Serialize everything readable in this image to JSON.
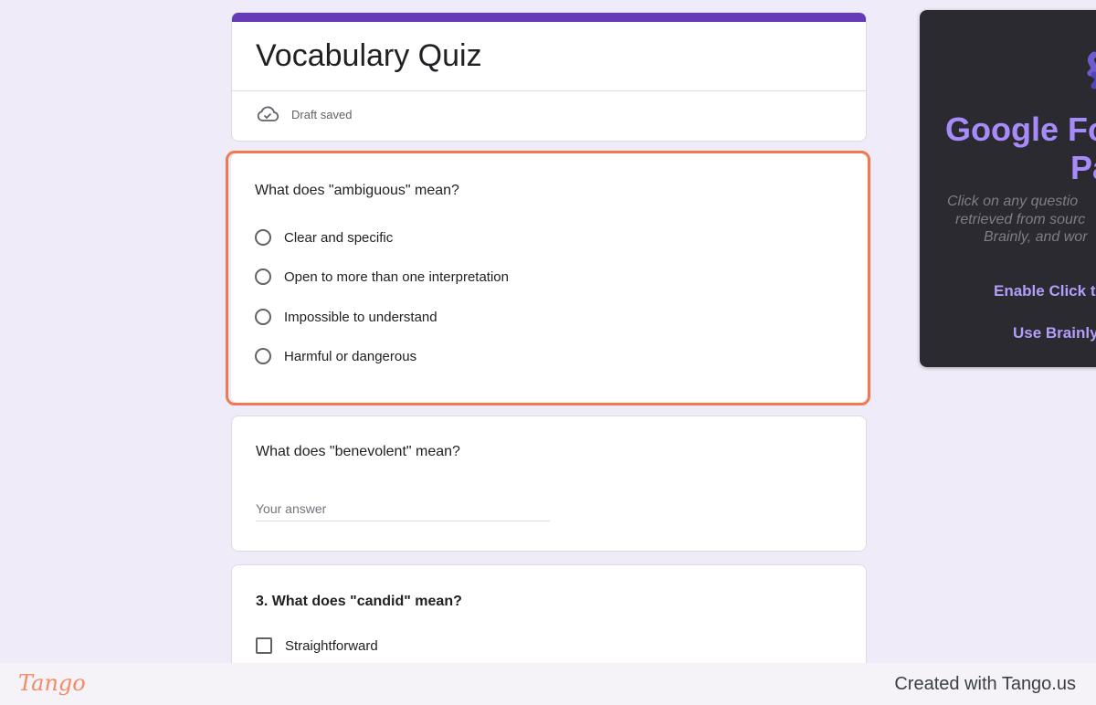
{
  "form": {
    "title": "Vocabulary Quiz",
    "status": "Draft saved",
    "accent_color": "#673ab7",
    "background_color": "#f0ebf8"
  },
  "questions": [
    {
      "text": "What does \"ambiguous\" mean?",
      "type": "radio",
      "options": [
        "Clear and specific",
        "Open to more than one interpretation",
        "Impossible to understand",
        "Harmful or dangerous"
      ],
      "highlighted": true
    },
    {
      "text": "What does \"benevolent\" mean?",
      "type": "short-answer",
      "placeholder": "Your answer"
    },
    {
      "text": "3. What does \"candid\" mean?",
      "type": "checkbox",
      "options": [
        "Straightforward"
      ]
    }
  ],
  "highlight_color": "#f07a4f",
  "extension": {
    "title_line1": "Google Fo",
    "title_line2": "Pa",
    "desc_line1": "Click on any questio",
    "desc_line2": "retrieved from sourc",
    "desc_line3": "Brainly, and wor",
    "link1": "Enable Click t",
    "link2": "Use Brainly",
    "title_color": "#a78bfa",
    "background_color": "#2a2a30"
  },
  "footer": {
    "logo": "Tango",
    "credit": "Created with Tango.us"
  }
}
